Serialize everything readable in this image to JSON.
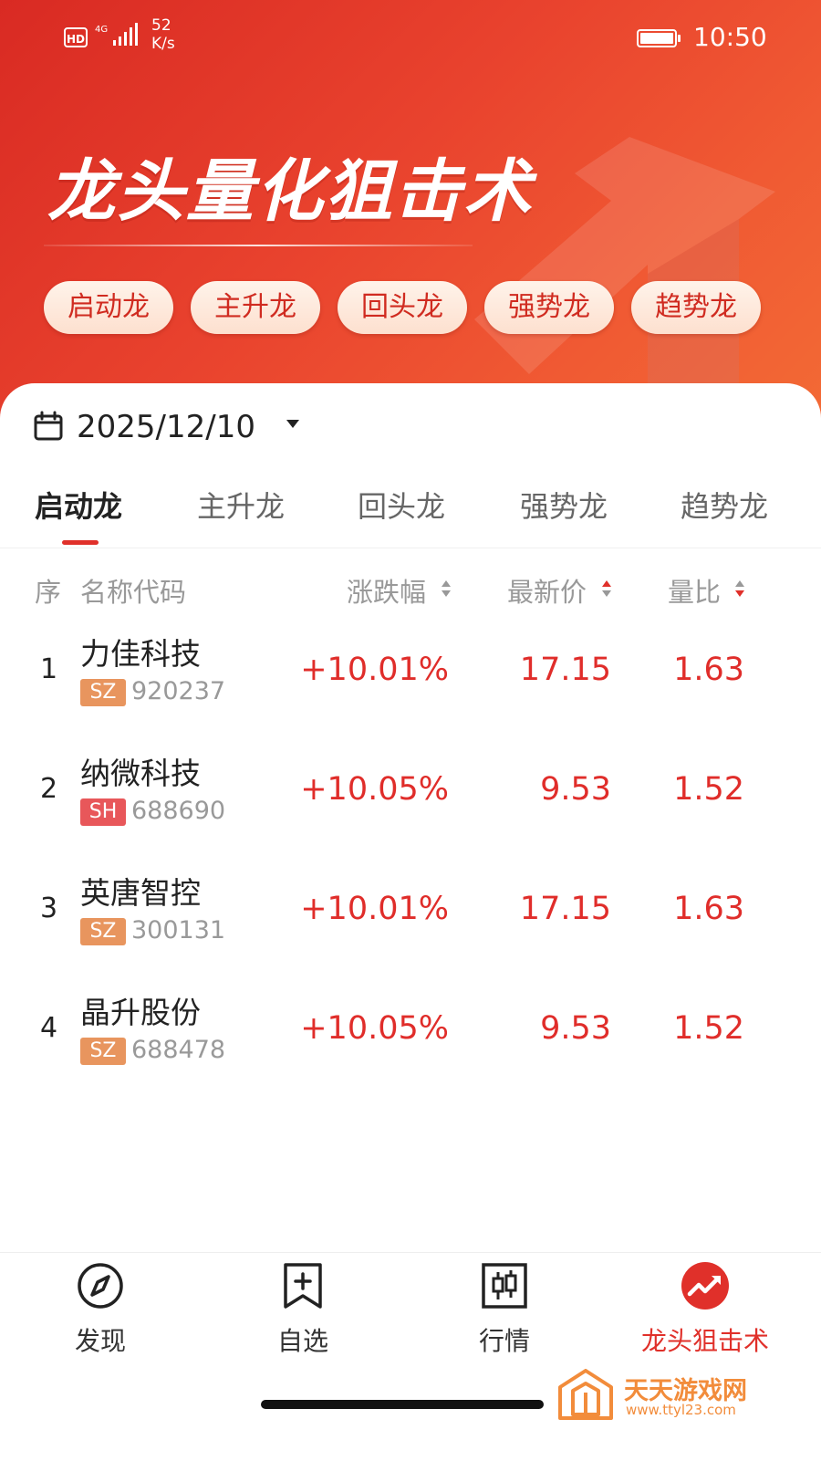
{
  "status_bar": {
    "hd": "HD",
    "network": "4G",
    "speed_value": "52",
    "speed_unit": "K/s",
    "time": "10:50"
  },
  "hero": {
    "title": "龙头量化狙击术",
    "chips": [
      "启动龙",
      "主升龙",
      "回头龙",
      "强势龙",
      "趋势龙"
    ]
  },
  "date_picker": {
    "value": "2025/12/10"
  },
  "tabs": [
    {
      "label": "启动龙",
      "active": true
    },
    {
      "label": "主升龙",
      "active": false
    },
    {
      "label": "回头龙",
      "active": false
    },
    {
      "label": "强势龙",
      "active": false
    },
    {
      "label": "趋势龙",
      "active": false
    }
  ],
  "table": {
    "headers": {
      "index": "序",
      "name_code": "名称代码",
      "change_pct": "涨跌幅",
      "latest_price": "最新价",
      "volume_ratio": "量比"
    },
    "rows": [
      {
        "index": "1",
        "name": "力佳科技",
        "market": "SZ",
        "code": "920237",
        "change_pct": "+10.01%",
        "price": "17.15",
        "volume_ratio": "1.63"
      },
      {
        "index": "2",
        "name": "纳微科技",
        "market": "SH",
        "code": "688690",
        "change_pct": "+10.05%",
        "price": "9.53",
        "volume_ratio": "1.52"
      },
      {
        "index": "3",
        "name": "英唐智控",
        "market": "SZ",
        "code": "300131",
        "change_pct": "+10.01%",
        "price": "17.15",
        "volume_ratio": "1.63"
      },
      {
        "index": "4",
        "name": "晶升股份",
        "market": "SZ",
        "code": "688478",
        "change_pct": "+10.05%",
        "price": "9.53",
        "volume_ratio": "1.52"
      }
    ]
  },
  "bottom_nav": [
    {
      "label": "发现",
      "icon": "compass-icon",
      "active": false
    },
    {
      "label": "自选",
      "icon": "bookmark-add-icon",
      "active": false
    },
    {
      "label": "行情",
      "icon": "candlestick-icon",
      "active": false
    },
    {
      "label": "龙头狙击术",
      "icon": "trend-arrow-icon",
      "active": true
    }
  ],
  "watermark": {
    "text": "天天游戏网",
    "url": "www.ttyl23.com"
  },
  "colors": {
    "brand_red": "#e0302a",
    "rise_red": "#e02d2a",
    "sz_badge": "#e8955e",
    "sh_badge": "#e8575a",
    "watermark_orange": "#f28c3b"
  }
}
